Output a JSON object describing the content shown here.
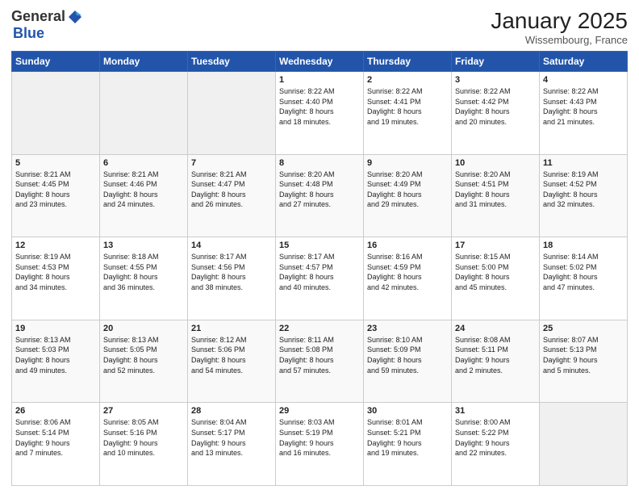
{
  "header": {
    "logo_general": "General",
    "logo_blue": "Blue",
    "month_title": "January 2025",
    "location": "Wissembourg, France"
  },
  "weekdays": [
    "Sunday",
    "Monday",
    "Tuesday",
    "Wednesday",
    "Thursday",
    "Friday",
    "Saturday"
  ],
  "weeks": [
    [
      {
        "day": "",
        "info": ""
      },
      {
        "day": "",
        "info": ""
      },
      {
        "day": "",
        "info": ""
      },
      {
        "day": "1",
        "info": "Sunrise: 8:22 AM\nSunset: 4:40 PM\nDaylight: 8 hours\nand 18 minutes."
      },
      {
        "day": "2",
        "info": "Sunrise: 8:22 AM\nSunset: 4:41 PM\nDaylight: 8 hours\nand 19 minutes."
      },
      {
        "day": "3",
        "info": "Sunrise: 8:22 AM\nSunset: 4:42 PM\nDaylight: 8 hours\nand 20 minutes."
      },
      {
        "day": "4",
        "info": "Sunrise: 8:22 AM\nSunset: 4:43 PM\nDaylight: 8 hours\nand 21 minutes."
      }
    ],
    [
      {
        "day": "5",
        "info": "Sunrise: 8:21 AM\nSunset: 4:45 PM\nDaylight: 8 hours\nand 23 minutes."
      },
      {
        "day": "6",
        "info": "Sunrise: 8:21 AM\nSunset: 4:46 PM\nDaylight: 8 hours\nand 24 minutes."
      },
      {
        "day": "7",
        "info": "Sunrise: 8:21 AM\nSunset: 4:47 PM\nDaylight: 8 hours\nand 26 minutes."
      },
      {
        "day": "8",
        "info": "Sunrise: 8:20 AM\nSunset: 4:48 PM\nDaylight: 8 hours\nand 27 minutes."
      },
      {
        "day": "9",
        "info": "Sunrise: 8:20 AM\nSunset: 4:49 PM\nDaylight: 8 hours\nand 29 minutes."
      },
      {
        "day": "10",
        "info": "Sunrise: 8:20 AM\nSunset: 4:51 PM\nDaylight: 8 hours\nand 31 minutes."
      },
      {
        "day": "11",
        "info": "Sunrise: 8:19 AM\nSunset: 4:52 PM\nDaylight: 8 hours\nand 32 minutes."
      }
    ],
    [
      {
        "day": "12",
        "info": "Sunrise: 8:19 AM\nSunset: 4:53 PM\nDaylight: 8 hours\nand 34 minutes."
      },
      {
        "day": "13",
        "info": "Sunrise: 8:18 AM\nSunset: 4:55 PM\nDaylight: 8 hours\nand 36 minutes."
      },
      {
        "day": "14",
        "info": "Sunrise: 8:17 AM\nSunset: 4:56 PM\nDaylight: 8 hours\nand 38 minutes."
      },
      {
        "day": "15",
        "info": "Sunrise: 8:17 AM\nSunset: 4:57 PM\nDaylight: 8 hours\nand 40 minutes."
      },
      {
        "day": "16",
        "info": "Sunrise: 8:16 AM\nSunset: 4:59 PM\nDaylight: 8 hours\nand 42 minutes."
      },
      {
        "day": "17",
        "info": "Sunrise: 8:15 AM\nSunset: 5:00 PM\nDaylight: 8 hours\nand 45 minutes."
      },
      {
        "day": "18",
        "info": "Sunrise: 8:14 AM\nSunset: 5:02 PM\nDaylight: 8 hours\nand 47 minutes."
      }
    ],
    [
      {
        "day": "19",
        "info": "Sunrise: 8:13 AM\nSunset: 5:03 PM\nDaylight: 8 hours\nand 49 minutes."
      },
      {
        "day": "20",
        "info": "Sunrise: 8:13 AM\nSunset: 5:05 PM\nDaylight: 8 hours\nand 52 minutes."
      },
      {
        "day": "21",
        "info": "Sunrise: 8:12 AM\nSunset: 5:06 PM\nDaylight: 8 hours\nand 54 minutes."
      },
      {
        "day": "22",
        "info": "Sunrise: 8:11 AM\nSunset: 5:08 PM\nDaylight: 8 hours\nand 57 minutes."
      },
      {
        "day": "23",
        "info": "Sunrise: 8:10 AM\nSunset: 5:09 PM\nDaylight: 8 hours\nand 59 minutes."
      },
      {
        "day": "24",
        "info": "Sunrise: 8:08 AM\nSunset: 5:11 PM\nDaylight: 9 hours\nand 2 minutes."
      },
      {
        "day": "25",
        "info": "Sunrise: 8:07 AM\nSunset: 5:13 PM\nDaylight: 9 hours\nand 5 minutes."
      }
    ],
    [
      {
        "day": "26",
        "info": "Sunrise: 8:06 AM\nSunset: 5:14 PM\nDaylight: 9 hours\nand 7 minutes."
      },
      {
        "day": "27",
        "info": "Sunrise: 8:05 AM\nSunset: 5:16 PM\nDaylight: 9 hours\nand 10 minutes."
      },
      {
        "day": "28",
        "info": "Sunrise: 8:04 AM\nSunset: 5:17 PM\nDaylight: 9 hours\nand 13 minutes."
      },
      {
        "day": "29",
        "info": "Sunrise: 8:03 AM\nSunset: 5:19 PM\nDaylight: 9 hours\nand 16 minutes."
      },
      {
        "day": "30",
        "info": "Sunrise: 8:01 AM\nSunset: 5:21 PM\nDaylight: 9 hours\nand 19 minutes."
      },
      {
        "day": "31",
        "info": "Sunrise: 8:00 AM\nSunset: 5:22 PM\nDaylight: 9 hours\nand 22 minutes."
      },
      {
        "day": "",
        "info": ""
      }
    ]
  ]
}
